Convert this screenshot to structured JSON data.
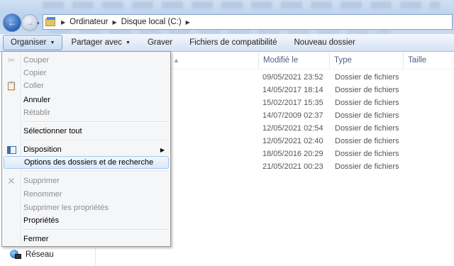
{
  "address": {
    "segments": [
      "Ordinateur",
      "Disque local (C:)"
    ],
    "dropdown_glyph": "▾"
  },
  "toolbar": {
    "organize": "Organiser",
    "share": "Partager avec",
    "burn": "Graver",
    "compat": "Fichiers de compatibilité",
    "new_folder": "Nouveau dossier"
  },
  "columns": {
    "date": "Modifié le",
    "type": "Type",
    "size": "Taille"
  },
  "files": [
    {
      "date": "09/05/2021 23:52",
      "type": "Dossier de fichiers"
    },
    {
      "date": "14/05/2017 18:14",
      "type": "Dossier de fichiers"
    },
    {
      "date": "15/02/2017 15:35",
      "type": "Dossier de fichiers"
    },
    {
      "date": "14/07/2009 02:37",
      "type": "Dossier de fichiers"
    },
    {
      "date": "12/05/2021 02:54",
      "type": "Dossier de fichiers"
    },
    {
      "date": "12/05/2021 02:40",
      "type": "Dossier de fichiers"
    },
    {
      "date": "18/05/2016 20:29",
      "type": "Dossier de fichiers"
    },
    {
      "date": "21/05/2021 00:23",
      "type": "Dossier de fichiers"
    }
  ],
  "menu": {
    "cut": "Couper",
    "copy": "Copier",
    "paste": "Coller",
    "undo": "Annuler",
    "redo": "Rétablir",
    "select_all": "Sélectionner tout",
    "layout": "Disposition",
    "folder_options": "Options des dossiers et de recherche",
    "delete": "Supprimer",
    "rename": "Renommer",
    "remove_props": "Supprimer les propriétés",
    "properties": "Propriétés",
    "close": "Fermer"
  },
  "nav": {
    "network": "Réseau"
  },
  "icons": [
    "back-arrow-icon",
    "forward-arrow-icon",
    "folder-icon",
    "scissors-icon",
    "clipboard-icon",
    "layout-icon",
    "delete-x-icon",
    "network-icon"
  ],
  "colors": {
    "command_bar": "#dbe6f4",
    "highlight_border": "#a8c8ee",
    "disabled_text": "#8d8d8d"
  }
}
